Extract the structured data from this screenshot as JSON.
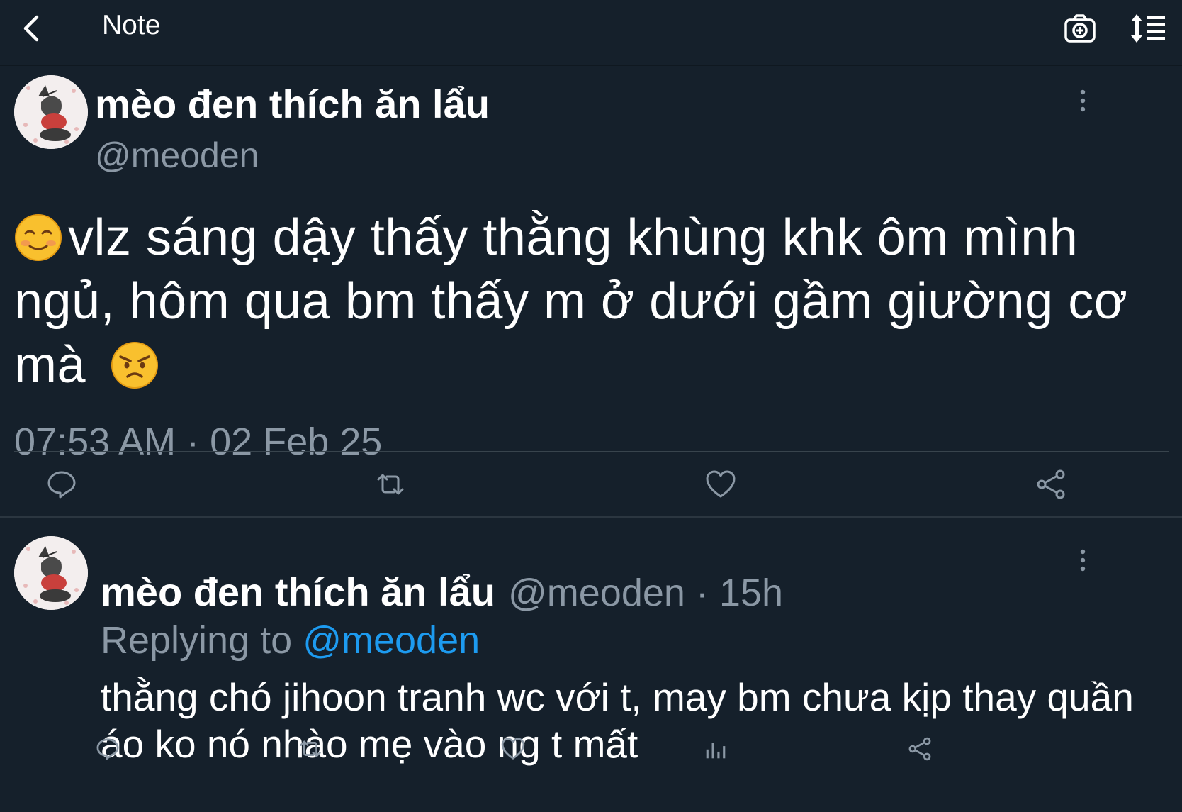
{
  "header": {
    "title": "Note",
    "back_icon": "chevron-left-icon",
    "camera_icon": "camera-plus-icon",
    "sort_icon": "sort-list-icon"
  },
  "tweet": {
    "display_name": "mèo đen thích ăn lẩu",
    "handle": "@meoden",
    "text_before": "vlz sáng dậy thấy thằng khùng khk ôm mình ngủ, hôm qua bm thấy m ở dưới gầm giường cơ mà",
    "emoji_start": "smiling-blush-emoji",
    "emoji_end": "angry-face-emoji",
    "timestamp": "07:53 AM · 02 Feb 25",
    "actions": [
      "reply-icon",
      "retweet-icon",
      "like-icon",
      "share-icon"
    ]
  },
  "reply": {
    "display_name": "mèo đen thích ăn lẩu",
    "meta": "@meoden · 15h",
    "replying_prefix": "Replying to",
    "replying_to": "@meoden",
    "text": "thằng chó jihoon tranh wc với t, may bm chưa kịp thay quần áo ko nó nhào mẹ vào ng t mất",
    "actions": [
      "reply-icon",
      "retweet-icon",
      "like-icon",
      "analytics-icon",
      "share-icon"
    ]
  },
  "colors": {
    "background": "#15202b",
    "secondary_text": "#8b98a5",
    "link": "#1d9bf0",
    "divider": "#38444d"
  }
}
